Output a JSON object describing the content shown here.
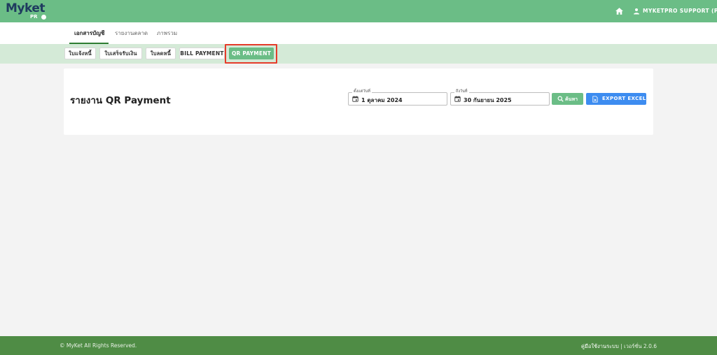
{
  "app": {
    "logo_text": "Myket",
    "logo_sub": "PR"
  },
  "header": {
    "user_name": "MYKETPRO SUPPORT (P)",
    "home_icon": "home-icon",
    "user_icon": "user-icon"
  },
  "tabs": [
    {
      "label": "เอกสารบัญชี",
      "active": true
    },
    {
      "label": "รายงานตลาด",
      "active": false
    },
    {
      "label": "ภาพรวม",
      "active": false
    }
  ],
  "subtabs": [
    {
      "label": "ใบแจ้งหนี้"
    },
    {
      "label": "ใบเสร็จรับเงิน"
    },
    {
      "label": "ใบลดหนี้"
    },
    {
      "label": "BILL PAYMENT"
    },
    {
      "label": "QR PAYMENT",
      "active": true
    }
  ],
  "main": {
    "title": "รายงาน QR Payment",
    "from_field": {
      "label": "ตั้งแต่วันที่",
      "value": "1 ตุลาคม 2024"
    },
    "to_field": {
      "label": "ถึงวันที่",
      "value": "30 กันยายน 2025"
    },
    "search_label": "ค้นหา",
    "export_label": "EXPORT EXCEL"
  },
  "footer": {
    "copyright": "© MyKet All Rights Reserved.",
    "manual_link": "คู่มือใช้งานระบบ",
    "separator": " | ",
    "version": "เวอร์ชั่น 2.0.6"
  },
  "colors": {
    "topbar": "#6bbd86",
    "subbar": "#d4ead7",
    "accent_green": "#6bbd86",
    "export_blue": "#3d8cf0",
    "footer": "#4f8c45",
    "highlight_red": "#e53b2a"
  }
}
